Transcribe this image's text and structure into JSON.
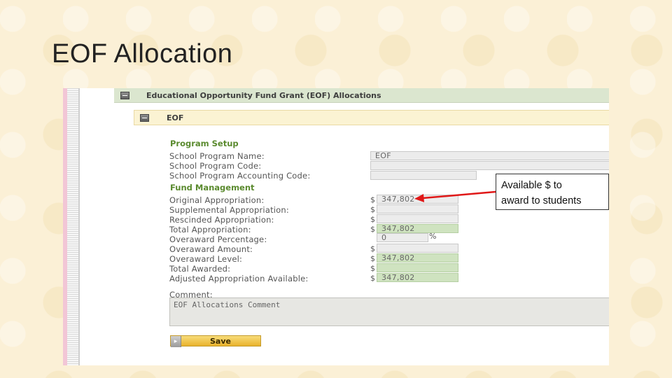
{
  "slide": {
    "title": "EOF Allocation"
  },
  "panel": {
    "section_title": "Educational Opportunity Fund Grant (EOF) Allocations",
    "subsection_title": "EOF"
  },
  "program_setup": {
    "heading": "Program Setup",
    "school_program_name_label": "School Program Name:",
    "school_program_name_value": "EOF",
    "school_program_code_label": "School Program Code:",
    "school_program_code_value": "",
    "accounting_code_label": "School Program Accounting Code:",
    "accounting_code_value": ""
  },
  "fund_management": {
    "heading": "Fund Management",
    "currency_symbol": "$",
    "percent_symbol": "%",
    "original_label": "Original Appropriation:",
    "original_value": "347,802",
    "supplemental_label": "Supplemental Appropriation:",
    "supplemental_value": "",
    "rescinded_label": "Rescinded Appropriation:",
    "rescinded_value": "",
    "total_label": "Total Appropriation:",
    "total_value": "347,802",
    "overaward_pct_label": "Overaward Percentage:",
    "overaward_pct_value": "0",
    "overaward_amount_label": "Overaward Amount:",
    "overaward_amount_value": "",
    "overaward_level_label": "Overaward Level:",
    "overaward_level_value": "347,802",
    "total_awarded_label": "Total Awarded:",
    "total_awarded_value": "",
    "adjusted_label": "Adjusted Appropriation Available:",
    "adjusted_value": "347,802"
  },
  "comment": {
    "label": "Comment:",
    "value": "EOF Allocations Comment"
  },
  "save_label": "Save",
  "callout": {
    "line1": "Available $ to",
    "line2": "award to students",
    "arrow_color": "#e01818"
  },
  "colors": {
    "header_bg": "#dbe6cf",
    "subheader_bg": "#fbf3d3",
    "group_title": "#5a8a2e",
    "field_green": "#cfe3c0"
  }
}
